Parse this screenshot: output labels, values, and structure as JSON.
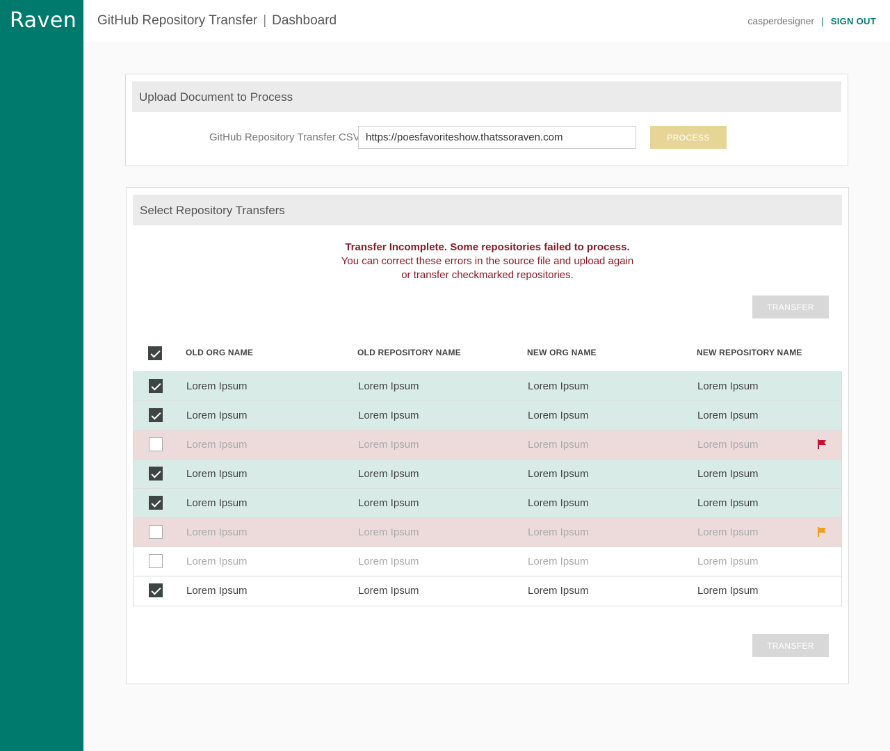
{
  "app": {
    "logo": "Raven",
    "title": "GitHub Repository Transfer",
    "page": "Dashboard"
  },
  "user": {
    "name": "casperdesigner",
    "sign_out": "SIGN OUT"
  },
  "upload": {
    "header": "Upload Document to Process",
    "csv_label": "GitHub Repository Transfer CSV",
    "csv_value": "https://poesfavoriteshow.thatssoraven.com",
    "process_label": "PROCESS"
  },
  "select": {
    "header": "Select Repository Transfers",
    "error_title": "Transfer Incomplete. Some repositories failed to process.",
    "error_line1": "You can correct these errors in the source file and upload again",
    "error_line2": "or transfer checkmarked repositories.",
    "transfer_label": "TRANSFER",
    "columns": [
      "OLD ORG NAME",
      "OLD REPOSITORY NAME",
      "NEW ORG NAME",
      "NEW REPOSITORY NAME"
    ],
    "rows": [
      {
        "cells": [
          "Lorem Ipsum",
          "Lorem Ipsum",
          "Lorem Ipsum",
          "Lorem Ipsum"
        ],
        "checked": true,
        "status": "ok",
        "flag": null
      },
      {
        "cells": [
          "Lorem Ipsum",
          "Lorem Ipsum",
          "Lorem Ipsum",
          "Lorem Ipsum"
        ],
        "checked": true,
        "status": "ok",
        "flag": null
      },
      {
        "cells": [
          "Lorem Ipsum",
          "Lorem Ipsum",
          "Lorem Ipsum",
          "Lorem Ipsum"
        ],
        "checked": false,
        "status": "err",
        "flag": "#c8102e"
      },
      {
        "cells": [
          "Lorem Ipsum",
          "Lorem Ipsum",
          "Lorem Ipsum",
          "Lorem Ipsum"
        ],
        "checked": true,
        "status": "ok",
        "flag": null
      },
      {
        "cells": [
          "Lorem Ipsum",
          "Lorem Ipsum",
          "Lorem Ipsum",
          "Lorem Ipsum"
        ],
        "checked": true,
        "status": "ok",
        "flag": null
      },
      {
        "cells": [
          "Lorem Ipsum",
          "Lorem Ipsum",
          "Lorem Ipsum",
          "Lorem Ipsum"
        ],
        "checked": false,
        "status": "err",
        "flag": "#f0a020"
      },
      {
        "cells": [
          "Lorem Ipsum",
          "Lorem Ipsum",
          "Lorem Ipsum",
          "Lorem Ipsum"
        ],
        "checked": false,
        "status": "plain",
        "flag": null
      },
      {
        "cells": [
          "Lorem Ipsum",
          "Lorem Ipsum",
          "Lorem Ipsum",
          "Lorem Ipsum"
        ],
        "checked": true,
        "status": "plain",
        "flag": null
      }
    ]
  },
  "colors": {
    "brand": "#007a6c",
    "error_text": "#8b1a26",
    "row_ok": "#d8ebe7",
    "row_err": "#eddbdb"
  }
}
